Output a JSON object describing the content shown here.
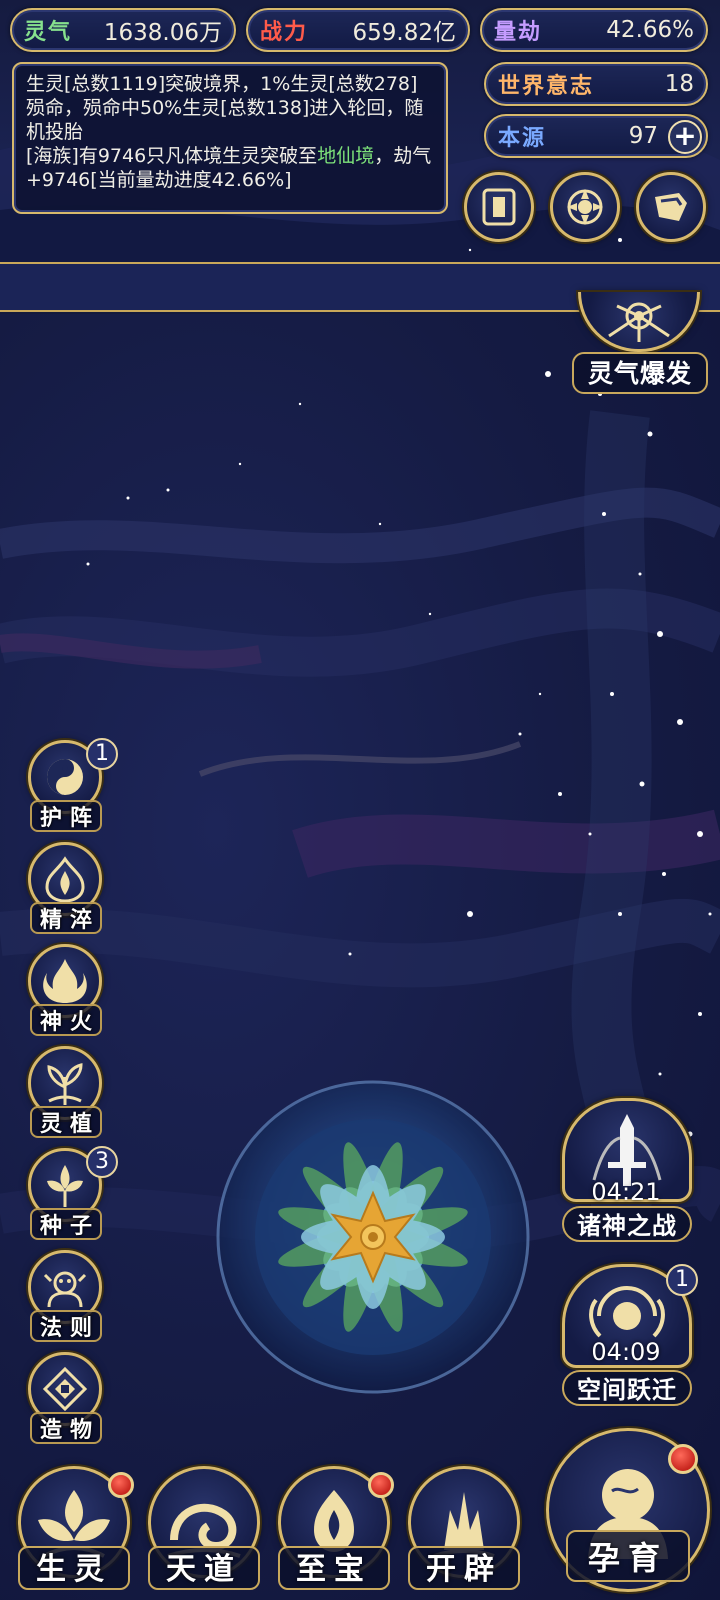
{
  "stats": {
    "lingqi": {
      "label": "灵气",
      "value": "1638.06万"
    },
    "zhanli": {
      "label": "战力",
      "value": "659.82亿"
    },
    "liangjie": {
      "label": "量劫",
      "value": "42.66%"
    },
    "world_will": {
      "label": "世界意志",
      "value": "18"
    },
    "benyuan": {
      "label": "本源",
      "value": "97",
      "plus": "+"
    }
  },
  "log": {
    "line1": "生灵[总数1119]突破境界，1%生灵[总数278]殒命，殒命中50%生灵[总数138]进入轮回，随机投胎",
    "line2_pre": "[海族]有9746只凡体境生灵突破至",
    "line2_hl": "地仙境",
    "line2_post": "，劫气+9746[当前量劫进度42.66%]"
  },
  "burst_button": {
    "label": "灵气爆发"
  },
  "side_menu": [
    {
      "label": "护阵",
      "badge": "1"
    },
    {
      "label": "精淬",
      "badge": ""
    },
    {
      "label": "神火",
      "badge": ""
    },
    {
      "label": "灵植",
      "badge": ""
    },
    {
      "label": "种子",
      "badge": "3"
    },
    {
      "label": "法则",
      "badge": ""
    },
    {
      "label": "造物",
      "badge": ""
    }
  ],
  "events": {
    "gods_war": {
      "label": "诸神之战",
      "timer": "04:21"
    },
    "space_jump": {
      "label": "空间跃迁",
      "timer": "04:09",
      "badge": "1"
    }
  },
  "bottom_nav": [
    {
      "label": "生灵",
      "has_dot": true
    },
    {
      "label": "天道",
      "has_dot": false
    },
    {
      "label": "至宝",
      "has_dot": true
    },
    {
      "label": "开辟",
      "has_dot": false
    }
  ],
  "main_action": {
    "label": "孕育",
    "has_dot": true
  },
  "colors": {
    "gold": "#d7b96c",
    "panel": "#141b45",
    "highlight_green": "#7de27a",
    "red_dot": "#c8261e"
  }
}
